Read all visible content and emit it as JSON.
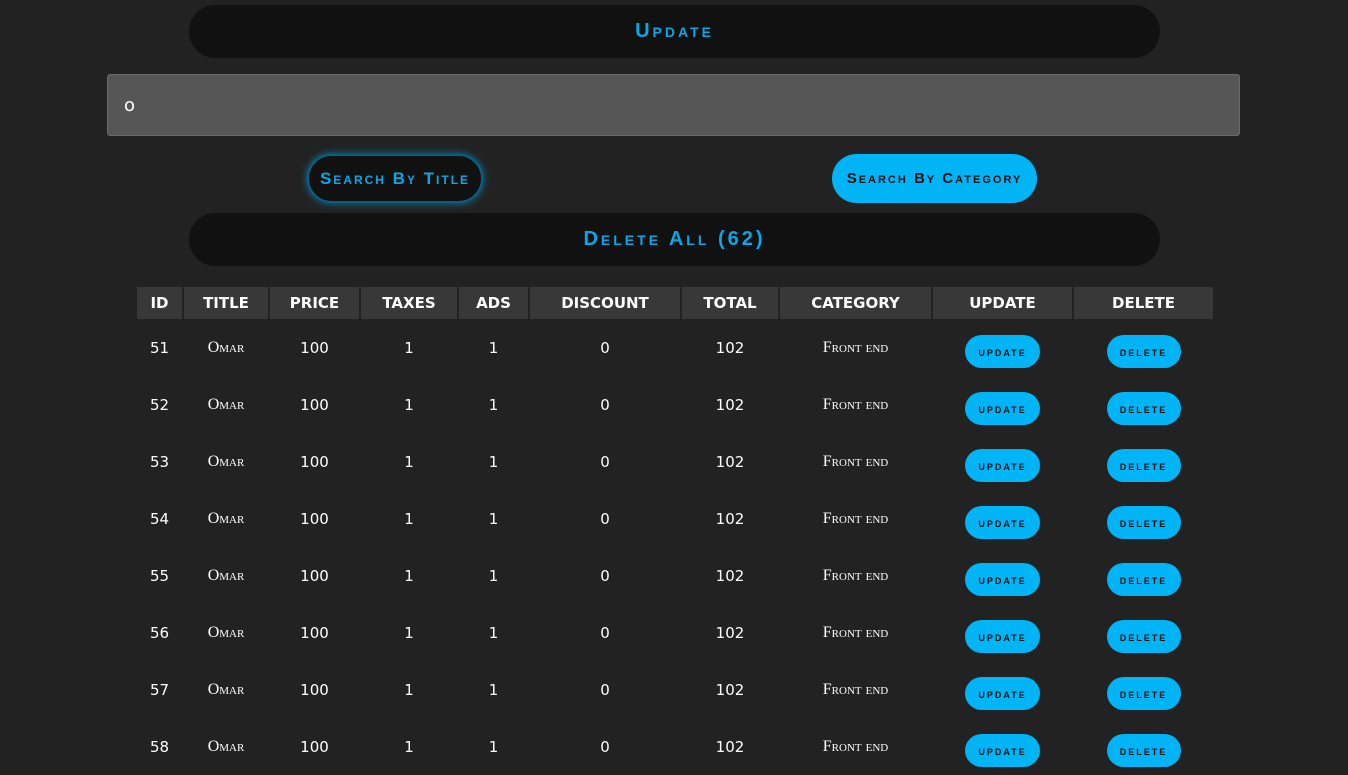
{
  "update_bar": {
    "label": "Update"
  },
  "search": {
    "value": "o"
  },
  "buttons": {
    "search_by_title": "Search By Title",
    "search_by_category": "Search By Category",
    "delete_all": "Delete All (62)"
  },
  "table": {
    "headers": [
      "ID",
      "TITLE",
      "PRICE",
      "TAXES",
      "ADS",
      "DISCOUNT",
      "TOTAL",
      "CATEGORY",
      "UPDATE",
      "DELETE"
    ],
    "row_update_label": "update",
    "row_delete_label": "delete",
    "rows": [
      {
        "id": "51",
        "title": "Omar",
        "price": "100",
        "taxes": "1",
        "ads": "1",
        "discount": "0",
        "total": "102",
        "category": "Front end"
      },
      {
        "id": "52",
        "title": "Omar",
        "price": "100",
        "taxes": "1",
        "ads": "1",
        "discount": "0",
        "total": "102",
        "category": "Front end"
      },
      {
        "id": "53",
        "title": "Omar",
        "price": "100",
        "taxes": "1",
        "ads": "1",
        "discount": "0",
        "total": "102",
        "category": "Front end"
      },
      {
        "id": "54",
        "title": "Omar",
        "price": "100",
        "taxes": "1",
        "ads": "1",
        "discount": "0",
        "total": "102",
        "category": "Front end"
      },
      {
        "id": "55",
        "title": "Omar",
        "price": "100",
        "taxes": "1",
        "ads": "1",
        "discount": "0",
        "total": "102",
        "category": "Front end"
      },
      {
        "id": "56",
        "title": "Omar",
        "price": "100",
        "taxes": "1",
        "ads": "1",
        "discount": "0",
        "total": "102",
        "category": "Front end"
      },
      {
        "id": "57",
        "title": "Omar",
        "price": "100",
        "taxes": "1",
        "ads": "1",
        "discount": "0",
        "total": "102",
        "category": "Front end"
      },
      {
        "id": "58",
        "title": "Omar",
        "price": "100",
        "taxes": "1",
        "ads": "1",
        "discount": "0",
        "total": "102",
        "category": "Front end"
      }
    ]
  },
  "colors": {
    "accent": "#00b4f5",
    "background": "#222222",
    "bar_background": "#111111",
    "header_background": "#383838"
  }
}
